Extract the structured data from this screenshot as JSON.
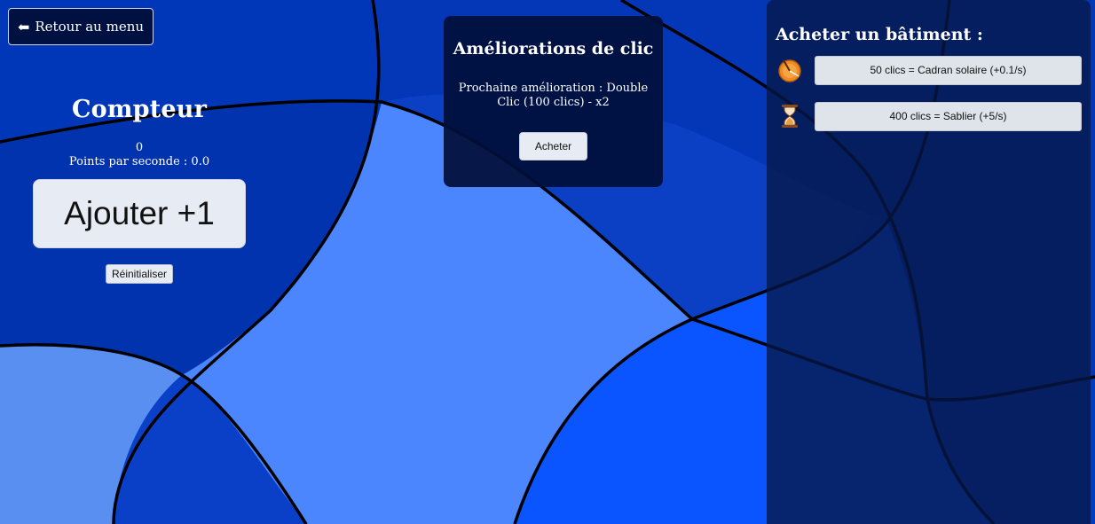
{
  "nav": {
    "back_label": "Retour au menu",
    "back_icon": "arrow-left-icon"
  },
  "counter": {
    "title": "Compteur",
    "value": "0",
    "pps_text": "Points par seconde : 0.0",
    "add_label": "Ajouter +1",
    "reset_label": "Réinitialiser"
  },
  "upgrades": {
    "title": "Améliorations de clic",
    "next_text": "Prochaine amélioration : Double Clic (100 clics) - x2",
    "buy_label": "Acheter"
  },
  "buildings": {
    "title": "Acheter un bâtiment :",
    "items": [
      {
        "icon": "sundial-icon",
        "label": "50 clics = Cadran solaire (+0.1/s)"
      },
      {
        "icon": "hourglass-icon",
        "label": "400 clics = Sablier (+5/s)"
      }
    ]
  },
  "colors": {
    "bg_dark": "#0035b0",
    "bg_mid": "#0a3fc2",
    "bg_light": "#4a86ff",
    "bg_bright": "#0a55ff",
    "panel_dark": "#000e38",
    "button_light": "#e7ebf4"
  }
}
